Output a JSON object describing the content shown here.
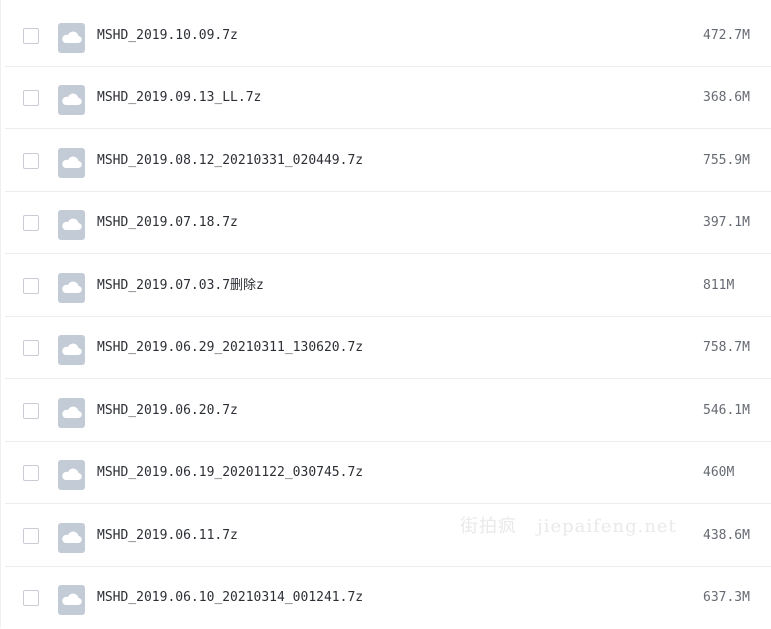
{
  "files": [
    {
      "name": "MSHD_2019.10.09.7z",
      "size": "472.7M"
    },
    {
      "name": "MSHD_2019.09.13_LL.7z",
      "size": "368.6M"
    },
    {
      "name": "MSHD_2019.08.12_20210331_020449.7z",
      "size": "755.9M"
    },
    {
      "name": "MSHD_2019.07.18.7z",
      "size": "397.1M"
    },
    {
      "name": "MSHD_2019.07.03.7删除z",
      "size": "811M"
    },
    {
      "name": "MSHD_2019.06.29_20210311_130620.7z",
      "size": "758.7M"
    },
    {
      "name": "MSHD_2019.06.20.7z",
      "size": "546.1M"
    },
    {
      "name": "MSHD_2019.06.19_20201122_030745.7z",
      "size": "460M"
    },
    {
      "name": "MSHD_2019.06.11.7z",
      "size": "438.6M"
    },
    {
      "name": "MSHD_2019.06.10_20210314_001241.7z",
      "size": "637.3M"
    }
  ],
  "icons": {
    "file": "cloud-file-icon",
    "checkbox": "checkbox"
  },
  "colors": {
    "icon_bg": "#c3cbd6",
    "icon_glyph": "#ffffff",
    "row_divider": "#ececec",
    "name_text": "#2c2f35",
    "size_text": "#666a72"
  },
  "watermark": "街拍疯   jiepaifeng.net"
}
